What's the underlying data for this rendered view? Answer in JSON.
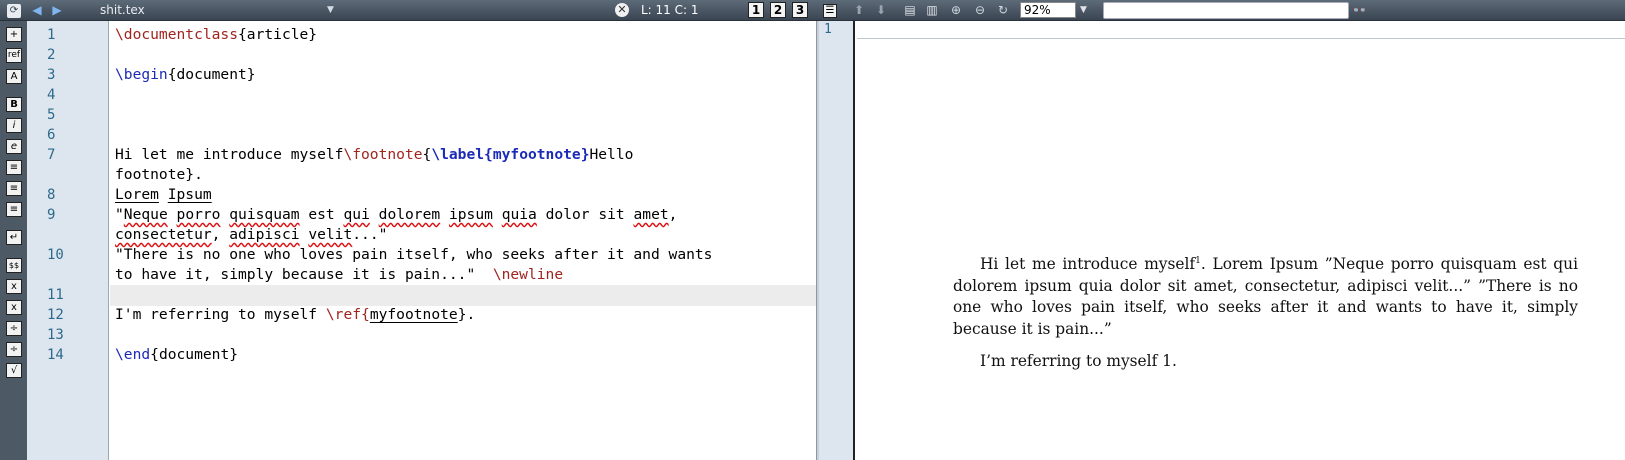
{
  "toolbar": {
    "file_name": "shit.tex",
    "cursor_position": "L: 11 C: 1",
    "view_buttons": [
      "1",
      "2",
      "3"
    ],
    "zoom": "92%",
    "search_value": ""
  },
  "side_tools": [
    "+",
    "ref",
    "A",
    "B",
    "i",
    "e",
    "≡",
    "≡",
    "≡",
    "↵",
    "$$",
    "x",
    "x",
    "÷",
    "÷",
    "√"
  ],
  "editor": {
    "line_numbers": [
      "1",
      "2",
      "3",
      "4",
      "5",
      "6",
      "7",
      "8",
      "9",
      "10",
      "11",
      "12",
      "13",
      "14"
    ],
    "lines": {
      "l1_cmd": "\\documentclass",
      "l1_arg": "{article}",
      "l3_cmd": "\\begin",
      "l3_arg": "{document}",
      "l7_text": "Hi let me introduce myself",
      "l7_cmd": "\\footnote",
      "l7_brace": "{",
      "l7_label": "\\label{myfootnote}",
      "l7_after": "Hello",
      "l7_wrap": "footnote}.",
      "l8_w1": "Lorem",
      "l8_w2": "Ipsum",
      "l9_q": "\"",
      "l9_w1": "Neque",
      "l9_w2": "porro",
      "l9_w3": "quisquam",
      "l9_t1": " est ",
      "l9_w4": "qui",
      "l9_w5": "dolorem",
      "l9_w6": "ipsum",
      "l9_w7": "quia",
      "l9_t2": " dolor sit ",
      "l9_w8": "amet",
      "l9_t3": ",",
      "l9_w9": "consectetur",
      "l9_w10": "adipisci",
      "l9_w11": "velit",
      "l9_t4": "...\"",
      "l10_a": "\"There is no one who loves pain itself, who seeks after it and wants",
      "l10_b": "to have it, simply because it is pain...\"  ",
      "l10_cmd": "\\newline",
      "l12_text": "I'm referring to myself ",
      "l12_cmd": "\\ref",
      "l12_open": "{",
      "l12_arg": "myfootnote",
      "l12_close": "}.",
      "l14_cmd": "\\end",
      "l14_arg": "{document}"
    }
  },
  "pdf": {
    "page_number": "1",
    "para1_a": "Hi let me introduce myself",
    "footnote_mark": "1",
    "para1_b": ". Lorem Ipsum ”Neque porro quisquam est qui dolorem ipsum quia dolor sit amet, consectetur, adipisci velit...” ”There is no one who loves pain itself, who seeks after it and wants to have it, simply because it is pain...”",
    "para2": "I’m referring to myself 1."
  }
}
